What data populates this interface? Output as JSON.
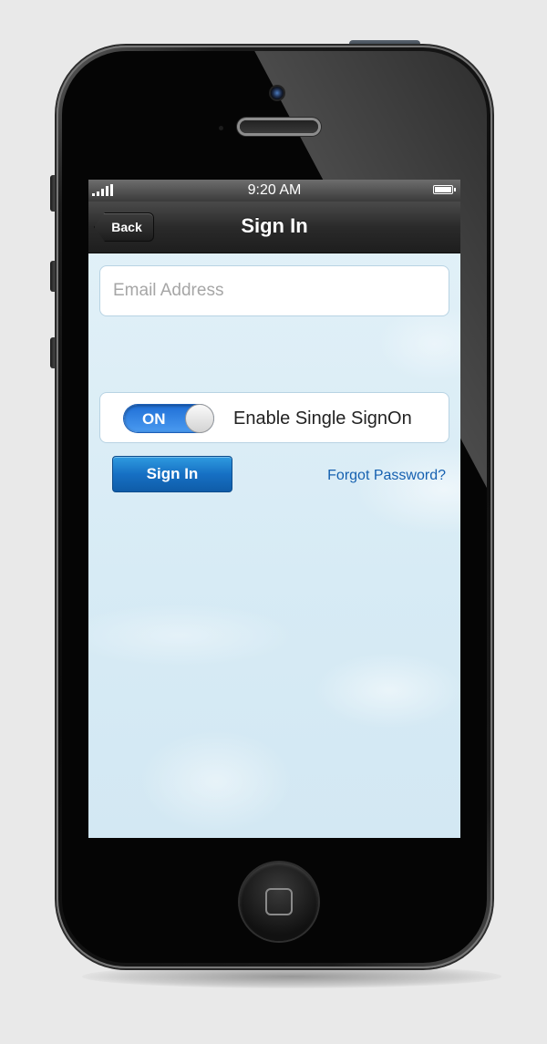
{
  "status_bar": {
    "time": "9:20 AM",
    "signal_icon": "signal-bars-icon",
    "battery_icon": "battery-full-icon"
  },
  "nav": {
    "back_label": "Back",
    "title": "Sign In"
  },
  "form": {
    "email_placeholder": "Email Address",
    "email_value": "",
    "sso_toggle_state": "ON",
    "sso_label": "Enable Single SignOn",
    "signin_label": "Sign In",
    "forgot_label": "Forgot Password?"
  },
  "colors": {
    "accent_blue": "#1670c4",
    "link_blue": "#1560b0",
    "background_sky": "#dcedf5",
    "page_background": "#e9e9e9"
  }
}
